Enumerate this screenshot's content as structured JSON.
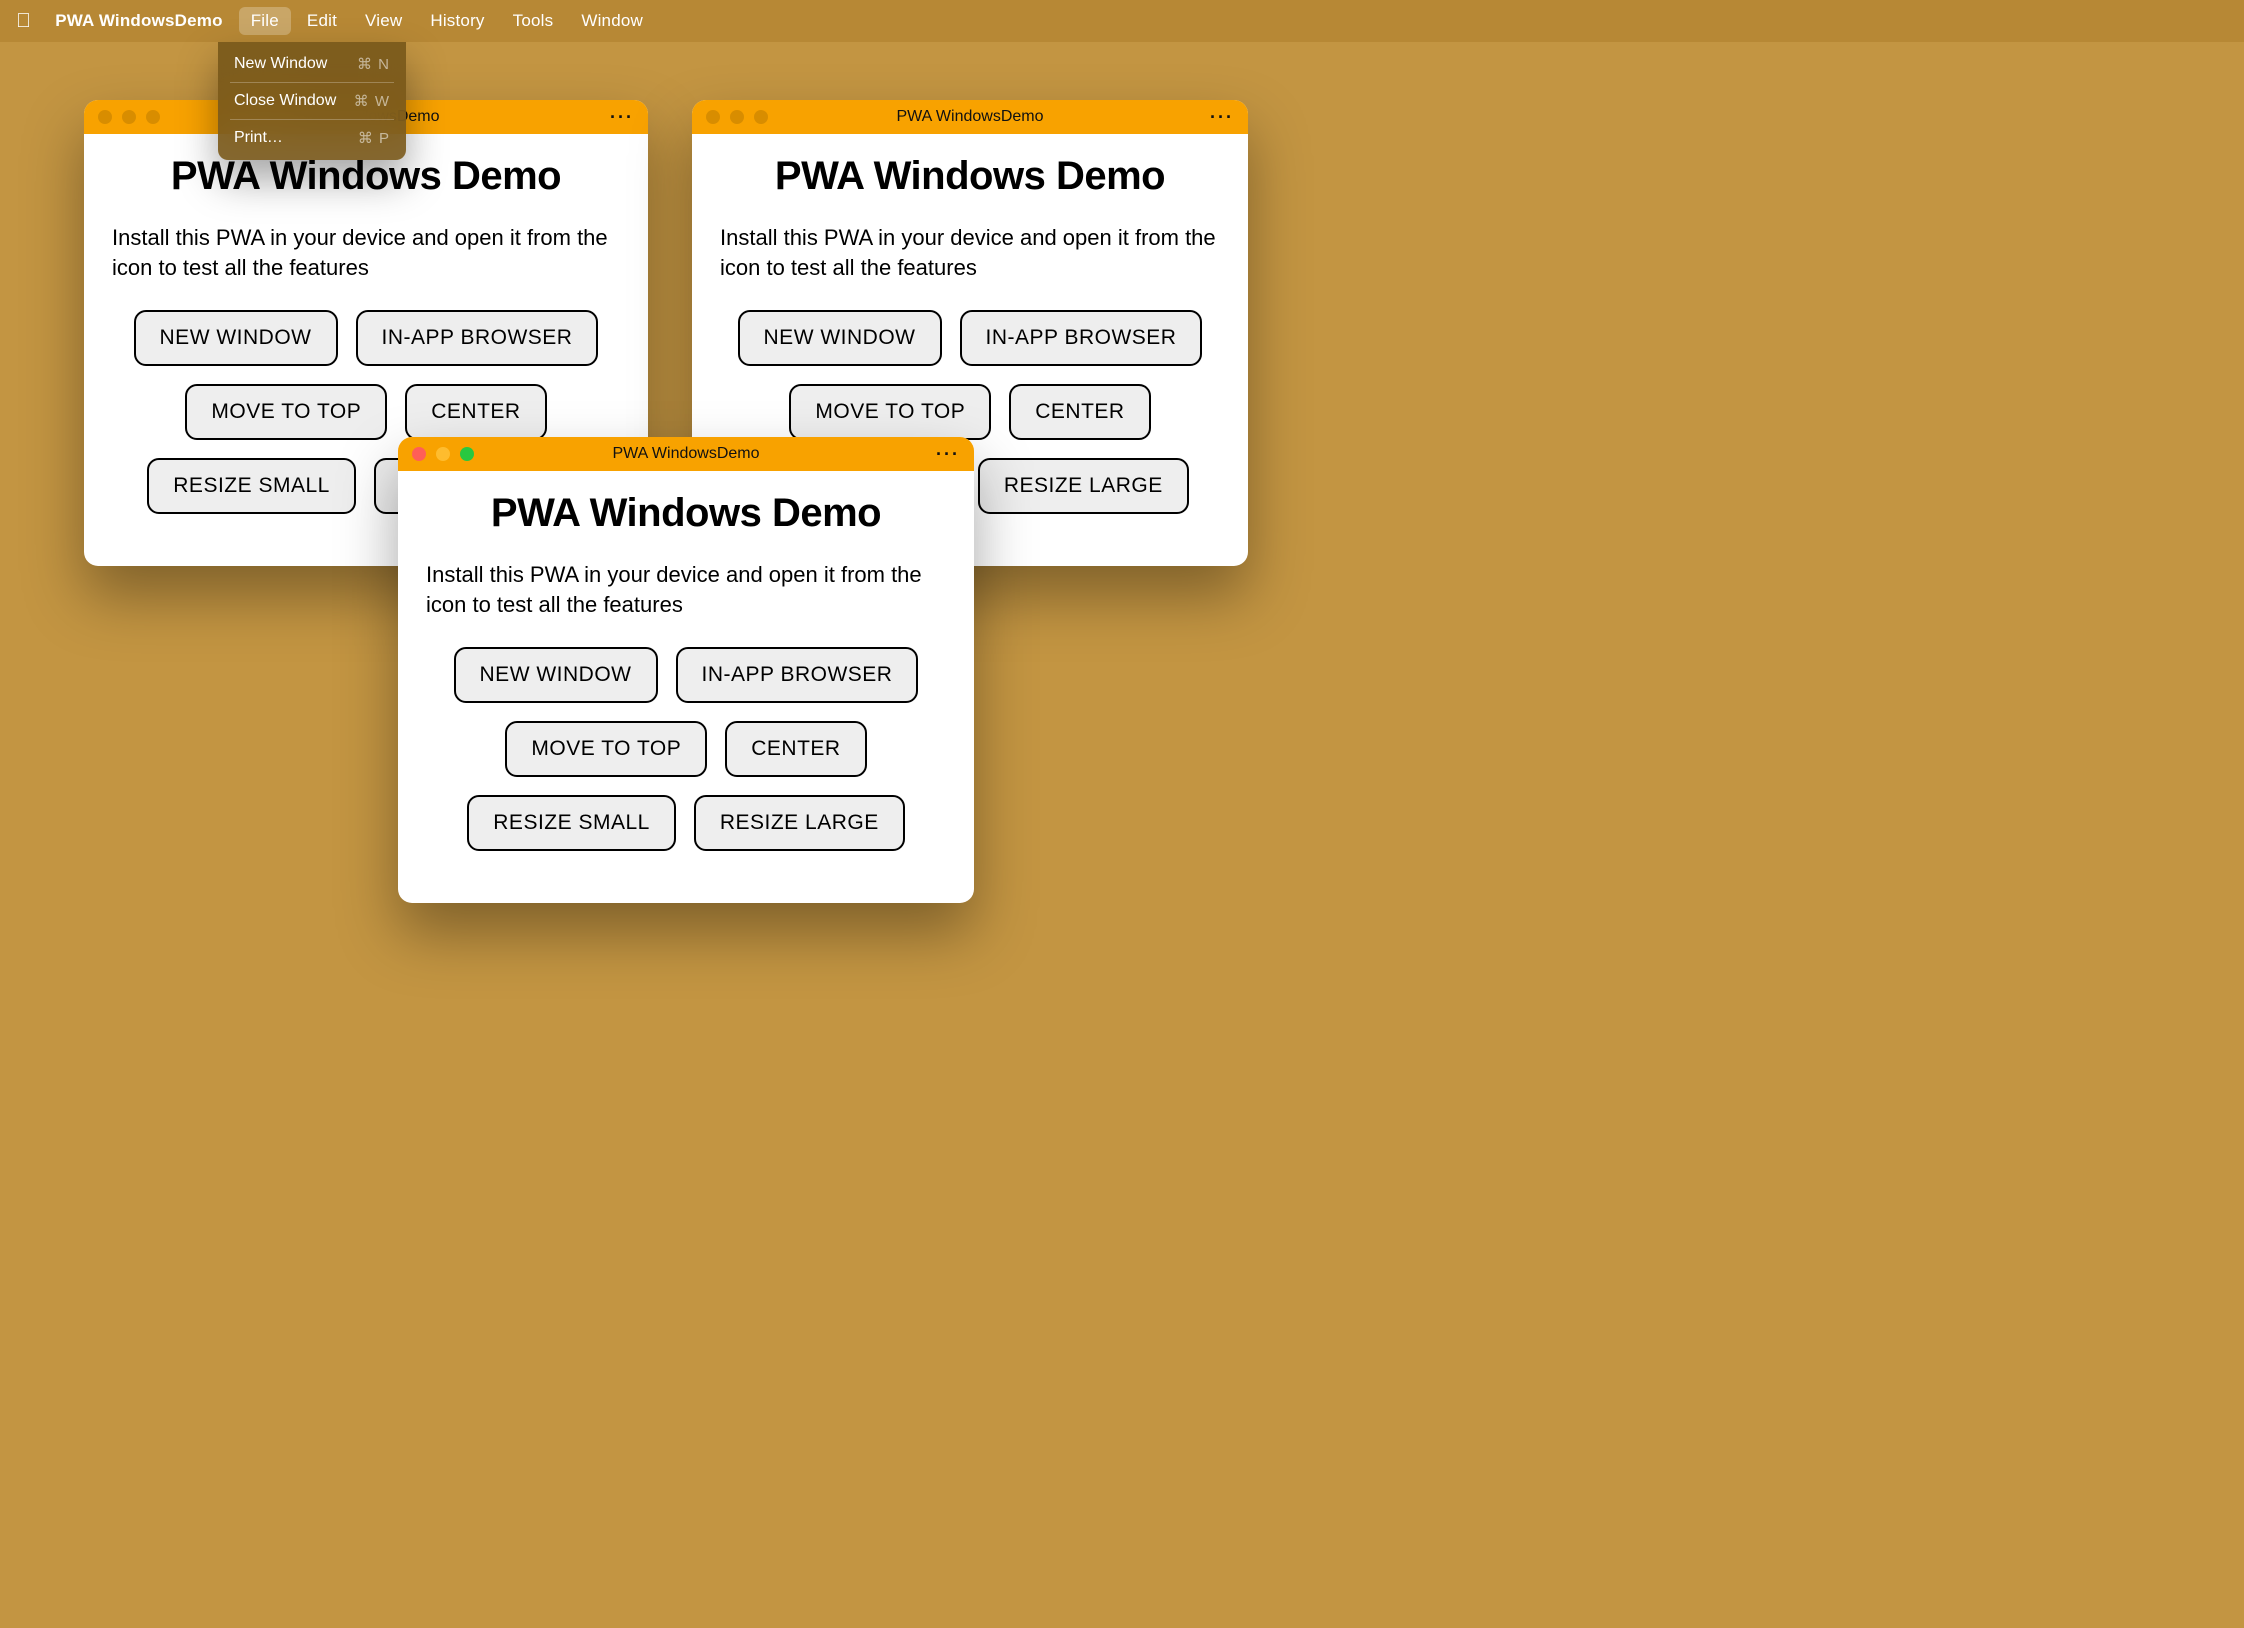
{
  "menubar": {
    "app_name": "PWA WindowsDemo",
    "items": [
      "File",
      "Edit",
      "View",
      "History",
      "Tools",
      "Window"
    ],
    "active_index": 0
  },
  "dropdown": {
    "items": [
      {
        "label": "New Window",
        "shortcut": "⌘ N"
      },
      {
        "label": "Close Window",
        "shortcut": "⌘ W"
      },
      {
        "label": "Print…",
        "shortcut": "⌘ P"
      }
    ]
  },
  "window_common": {
    "title": "PWA WindowsDemo",
    "heading": "PWA Windows Demo",
    "desc": "Install this PWA in your device and open it from the icon to test all the features",
    "buttons": {
      "new_window": "NEW WINDOW",
      "in_app_browser": "IN-APP BROWSER",
      "move_to_top": "MOVE TO TOP",
      "center": "CENTER",
      "resize_small": "RESIZE SMALL",
      "resize_large": "RESIZE LARGE"
    },
    "more_glyph": "···"
  },
  "colors": {
    "desktop": "#c39542",
    "titlebar": "#f8a200"
  }
}
